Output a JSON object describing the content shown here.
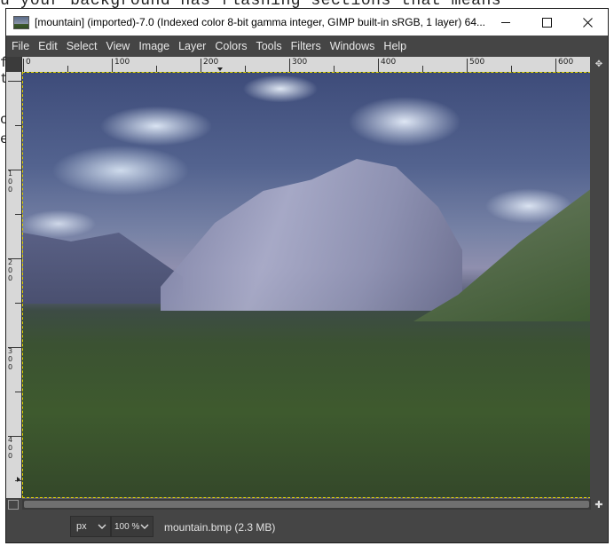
{
  "background_document": {
    "line1": "u your background has flashing sections that means",
    "fragments": [
      "f",
      "t",
      "c",
      "e"
    ]
  },
  "window": {
    "title": "[mountain] (imported)-7.0 (Indexed color 8-bit gamma integer, GIMP built-in sRGB, 1 layer) 64..."
  },
  "menu": [
    "File",
    "Edit",
    "Select",
    "View",
    "Image",
    "Layer",
    "Colors",
    "Tools",
    "Filters",
    "Windows",
    "Help"
  ],
  "hruler_labels": [
    "0",
    "100",
    "200",
    "300",
    "400",
    "500",
    "600"
  ],
  "vruler_labels": [
    "1\n0\n0",
    "2\n0\n0",
    "3\n0\n0",
    "4\n0\n0"
  ],
  "status": {
    "unit": "px",
    "zoom": "100 %",
    "file_info": "mountain.bmp (2.3 MB)"
  },
  "colors": {
    "ui_dark": "#454545",
    "selection_border": "#e5d500",
    "ruler": "#d8d8d8"
  },
  "icons": [
    "app-icon",
    "minimize-icon",
    "maximize-icon",
    "close-icon",
    "navigate-icon",
    "quick-mask-icon",
    "zoom-icon",
    "chevron-down-icon"
  ]
}
